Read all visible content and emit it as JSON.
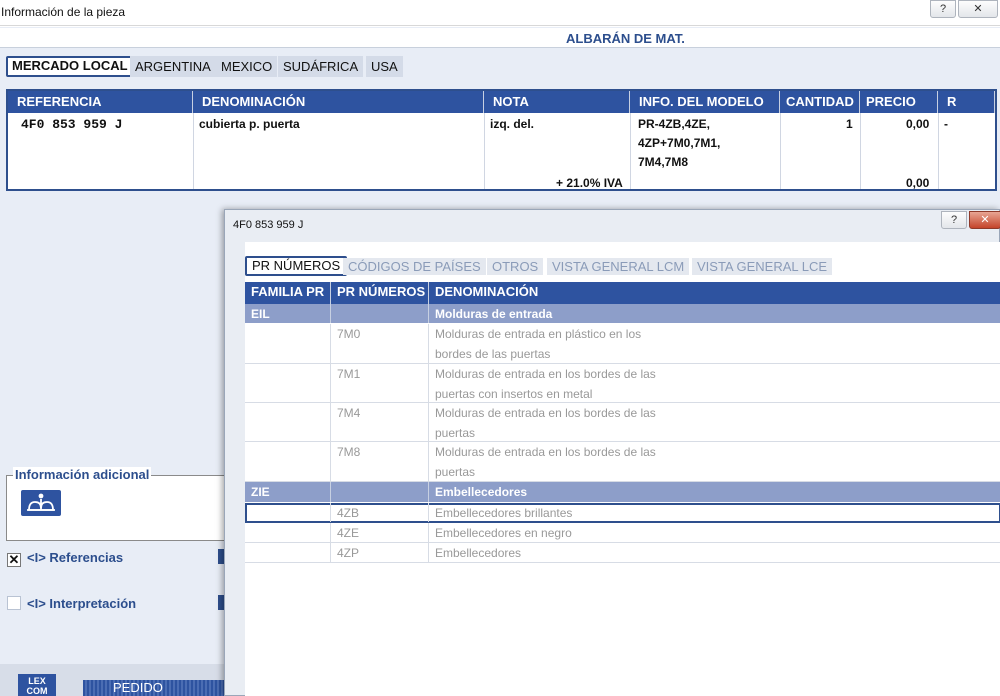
{
  "window": {
    "title": "Información de la pieza",
    "help_label": "?",
    "close_label": "✕"
  },
  "document": {
    "title": "ALBARÁN DE MAT."
  },
  "market_tabs": [
    {
      "label": "MERCADO LOCAL",
      "active": true
    },
    {
      "label": "ARGENTINA",
      "active": false
    },
    {
      "label": "MEXICO",
      "active": false
    },
    {
      "label": "SUDÁFRICA",
      "active": false
    },
    {
      "label": "USA",
      "active": false
    }
  ],
  "parts_table": {
    "columns": [
      "REFERENCIA",
      "DENOMINACIÓN",
      "NOTA",
      "INFO. DEL MODELO",
      "CANTIDAD",
      "PRECIO",
      "R"
    ],
    "row": {
      "referencia": "4F0 853 959 J",
      "denominacion": "cubierta p. puerta",
      "nota": "izq. del.",
      "info_modelo": [
        "PR-4ZB,4ZE,",
        "4ZP+7M0,7M1,",
        "7M4,7M8"
      ],
      "cantidad": "1",
      "precio": "0,00",
      "r": "-",
      "iva_label": "+ 21.0% IVA",
      "iva_precio": "0,00"
    }
  },
  "additional_info": {
    "legend": "Información adicional",
    "icon": "model-info-icon"
  },
  "checkboxes": [
    {
      "label": "<I> Referencias",
      "checked": true,
      "mark": "✕"
    },
    {
      "label": "<I> Interpretación",
      "checked": false,
      "mark": ""
    }
  ],
  "bottom_bar": {
    "logo_text": "LEX COM",
    "pedido_label": "PEDIDO"
  },
  "popup": {
    "title": "4F0 853 959 J",
    "help_label": "?",
    "close_label": "✕",
    "tabs": [
      {
        "label": "PR NÚMEROS",
        "active": true
      },
      {
        "label": "CÓDIGOS DE PAÍSES",
        "active": false
      },
      {
        "label": "OTROS",
        "active": false
      },
      {
        "label": "VISTA GENERAL LCM",
        "active": false
      },
      {
        "label": "VISTA GENERAL LCE",
        "active": false
      }
    ],
    "columns": [
      "FAMILIA PR",
      "PR NÚMEROS",
      "DENOMINACIÓN"
    ],
    "rows": [
      {
        "type": "group",
        "familia": "EIL",
        "pr": "",
        "denominacion": [
          "Molduras de entrada"
        ]
      },
      {
        "type": "item",
        "familia": "",
        "pr": "7M0",
        "denominacion": [
          "Molduras de entrada en plástico en los",
          "bordes de las puertas"
        ]
      },
      {
        "type": "item",
        "familia": "",
        "pr": "7M1",
        "denominacion": [
          "Molduras de entrada en los bordes de las",
          "puertas con insertos en metal"
        ]
      },
      {
        "type": "item",
        "familia": "",
        "pr": "7M4",
        "denominacion": [
          "Molduras de entrada en los bordes de las",
          "puertas"
        ]
      },
      {
        "type": "item",
        "familia": "",
        "pr": "7M8",
        "denominacion": [
          "Molduras de entrada en los bordes de las",
          "puertas"
        ]
      },
      {
        "type": "group",
        "familia": "ZIE",
        "pr": "",
        "denominacion": [
          "Embellecedores"
        ]
      },
      {
        "type": "item",
        "familia": "",
        "pr": "4ZB",
        "denominacion": [
          "Embellecedores brillantes"
        ],
        "selected": true
      },
      {
        "type": "item",
        "familia": "",
        "pr": "4ZE",
        "denominacion": [
          "Embellecedores en negro"
        ]
      },
      {
        "type": "item",
        "familia": "",
        "pr": "4ZP",
        "denominacion": [
          "Embellecedores"
        ]
      }
    ]
  },
  "colors": {
    "header_blue": "#2e53a0",
    "group_blue": "#8d9ec9",
    "background": "#e8edf6"
  }
}
